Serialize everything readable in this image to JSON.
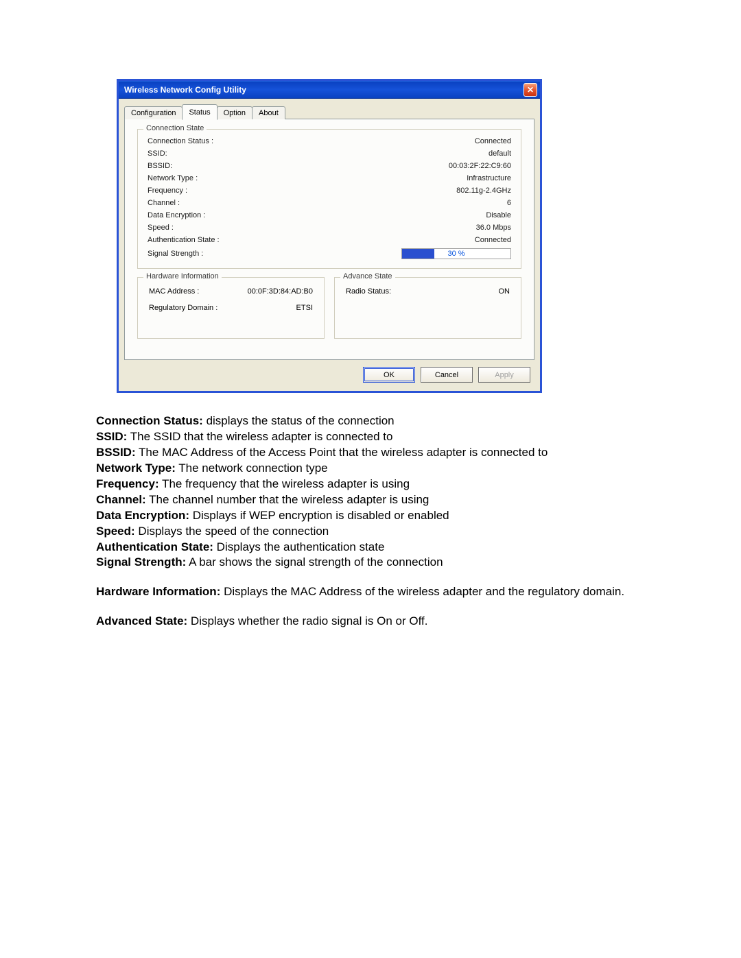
{
  "window": {
    "title": "Wireless Network Config Utility"
  },
  "tabs": {
    "configuration": "Configuration",
    "status": "Status",
    "option": "Option",
    "about": "About"
  },
  "groups": {
    "connection_state": "Connection State",
    "hardware_info": "Hardware Information",
    "advance_state": "Advance State"
  },
  "conn": {
    "status_label": "Connection Status :",
    "status_value": "Connected",
    "ssid_label": "SSID:",
    "ssid_value": "default",
    "bssid_label": "BSSID:",
    "bssid_value": "00:03:2F:22:C9:60",
    "nettype_label": "Network Type :",
    "nettype_value": "Infrastructure",
    "freq_label": "Frequency :",
    "freq_value": "802.11g-2.4GHz",
    "chan_label": "Channel :",
    "chan_value": "6",
    "enc_label": "Data Encryption :",
    "enc_value": "Disable",
    "speed_label": "Speed :",
    "speed_value": "36.0  Mbps",
    "auth_label": "Authentication State :",
    "auth_value": "Connected",
    "signal_label": "Signal Strength :",
    "signal_pct": 30,
    "signal_text": "30 %"
  },
  "hw": {
    "mac_label": "MAC Address :",
    "mac_value": "00:0F:3D:84:AD:B0",
    "reg_label": "Regulatory Domain :",
    "reg_value": "ETSI"
  },
  "adv": {
    "radio_label": "Radio Status:",
    "radio_value": "ON"
  },
  "buttons": {
    "ok": "OK",
    "cancel": "Cancel",
    "apply": "Apply"
  },
  "doc": {
    "l1b": "Connection Status:",
    "l1": " displays the status of the connection",
    "l2b": "SSID:",
    "l2": " The SSID that the wireless adapter is connected to",
    "l3b": "BSSID:",
    "l3": " The MAC Address of the Access Point that the wireless adapter is connected to",
    "l4b": "Network Type:",
    "l4": " The network connection type",
    "l5b": "Frequency:",
    "l5": " The frequency that the wireless adapter is using",
    "l6b": "Channel:",
    "l6": " The channel number that the wireless adapter is using",
    "l7b": "Data Encryption:",
    "l7": " Displays if WEP encryption is disabled or enabled",
    "l8b": "Speed:",
    "l8": " Displays the speed of the connection",
    "l9b": "Authentication State:",
    "l9": " Displays the authentication state",
    "l10b": "Signal Strength:",
    "l10": " A bar shows the signal strength of the connection",
    "l11b": "Hardware Information:",
    "l11": " Displays the MAC Address of the wireless adapter and the regulatory domain.",
    "l12b": "Advanced State:",
    "l12": " Displays whether the radio signal is On or Off."
  }
}
